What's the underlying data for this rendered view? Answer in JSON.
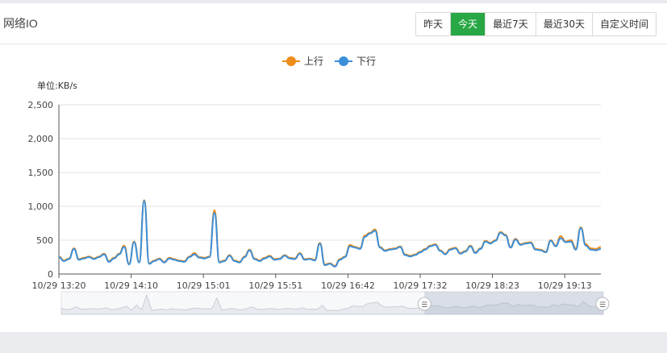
{
  "header": {
    "title": "网络IO",
    "range_buttons": [
      {
        "label": "昨天",
        "active": false
      },
      {
        "label": "今天",
        "active": true
      },
      {
        "label": "最近7天",
        "active": false
      },
      {
        "label": "最近30天",
        "active": false
      },
      {
        "label": "自定义时间",
        "active": false
      }
    ]
  },
  "colors": {
    "accent": "#28a745",
    "upstream": "#f08c1a",
    "downstream": "#3b8fd9"
  },
  "chart_data": {
    "type": "line",
    "unit_label": "单位:KB/s",
    "ylim": [
      0,
      2500
    ],
    "y_ticks": [
      "0",
      "500",
      "1,000",
      "1,500",
      "2,000",
      "2,500"
    ],
    "x_tick_labels": [
      "10/29 13:20",
      "10/29 14:10",
      "10/29 15:01",
      "10/29 15:51",
      "10/29 16:42",
      "10/29 17:32",
      "10/29 18:23",
      "10/29 19:13"
    ],
    "legend_position": "top-center",
    "grid": true,
    "series": [
      {
        "name": "上行",
        "color": "#f08c1a",
        "values": [
          260,
          200,
          230,
          380,
          220,
          240,
          260,
          230,
          260,
          300,
          190,
          240,
          300,
          420,
          150,
          480,
          180,
          1090,
          160,
          200,
          230,
          180,
          240,
          220,
          200,
          190,
          260,
          310,
          250,
          240,
          260,
          940,
          180,
          200,
          280,
          200,
          180,
          260,
          360,
          230,
          200,
          240,
          270,
          220,
          230,
          280,
          240,
          230,
          310,
          220,
          230,
          210,
          460,
          140,
          160,
          120,
          220,
          260,
          430,
          400,
          380,
          570,
          610,
          660,
          400,
          350,
          370,
          380,
          410,
          290,
          270,
          290,
          330,
          370,
          420,
          440,
          350,
          300,
          370,
          390,
          310,
          340,
          420,
          320,
          380,
          490,
          460,
          500,
          620,
          580,
          400,
          520,
          440,
          460,
          470,
          370,
          360,
          330,
          500,
          420,
          560,
          480,
          500,
          380,
          690,
          440,
          380,
          370,
          400
        ],
        "x_start_tick": 0,
        "x_end_value": "after 10/29 19:13"
      },
      {
        "name": "下行",
        "color": "#3b8fd9",
        "values": [
          250,
          190,
          220,
          370,
          210,
          230,
          250,
          220,
          250,
          290,
          180,
          230,
          290,
          400,
          140,
          470,
          170,
          1080,
          150,
          190,
          220,
          170,
          230,
          210,
          190,
          180,
          250,
          290,
          240,
          230,
          250,
          900,
          170,
          190,
          270,
          190,
          170,
          250,
          350,
          220,
          190,
          230,
          260,
          210,
          220,
          270,
          230,
          220,
          300,
          210,
          220,
          200,
          450,
          130,
          150,
          110,
          210,
          250,
          410,
          390,
          370,
          550,
          600,
          640,
          390,
          340,
          360,
          370,
          400,
          280,
          260,
          280,
          320,
          360,
          410,
          430,
          340,
          290,
          360,
          380,
          300,
          330,
          410,
          310,
          370,
          480,
          450,
          490,
          610,
          570,
          390,
          510,
          430,
          450,
          460,
          360,
          350,
          320,
          490,
          410,
          530,
          470,
          480,
          360,
          680,
          420,
          360,
          350,
          370
        ]
      }
    ]
  },
  "zoom_slider": {
    "start_handle_label": "☰",
    "end_handle_label": "☰",
    "selected_start_fraction": 0.67,
    "selected_end_fraction": 1.0
  }
}
